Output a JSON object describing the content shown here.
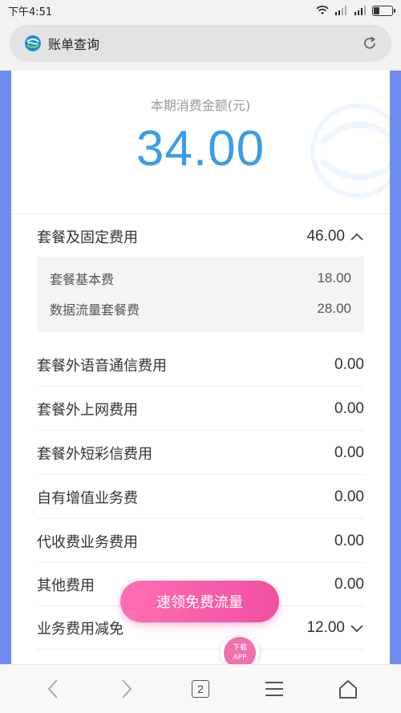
{
  "status_bar": {
    "time": "下午4:51",
    "battery_level": 0.3
  },
  "address_bar": {
    "title": "账单查询",
    "logo_icon": "china-mobile-logo",
    "refresh_icon": "refresh-icon"
  },
  "summary": {
    "label": "本期消费金额(元)",
    "amount": "34.00"
  },
  "bill_items": [
    {
      "label": "套餐及固定费用",
      "value": "46.00",
      "expanded": true
    },
    {
      "label": "套餐外语音通信费用",
      "value": "0.00"
    },
    {
      "label": "套餐外上网费用",
      "value": "0.00"
    },
    {
      "label": "套餐外短彩信费用",
      "value": "0.00"
    },
    {
      "label": "自有增值业务费",
      "value": "0.00"
    },
    {
      "label": "代收费业务费用",
      "value": "0.00"
    },
    {
      "label": "其他费用",
      "value": "0.00"
    },
    {
      "label": "业务费用减免",
      "value": "12.00",
      "expanded": false
    }
  ],
  "sub_items": [
    {
      "label": "套餐基本费",
      "value": "18.00"
    },
    {
      "label": "数据流量套餐费",
      "value": "28.00"
    }
  ],
  "promo": {
    "button_label": "速领免费流量",
    "download_label_line1": "下载",
    "download_label_line2": "APP"
  },
  "bottom_nav": {
    "tab_count": "2"
  },
  "colors": {
    "accent_blue": "#3d9ce8",
    "side_blue": "#6f8cf0",
    "promo_pink": "#f04fa0"
  }
}
